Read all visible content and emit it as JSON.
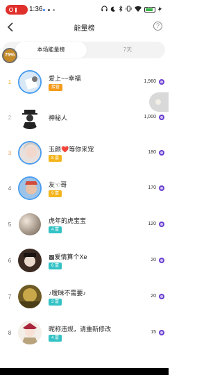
{
  "status_bar": {
    "time": "1:36",
    "battery": "68",
    "icons": [
      "headphones-icon",
      "moon-icon",
      "bluetooth-icon",
      "vibrate-icon",
      "wifi-icon",
      "battery-icon",
      "charging-icon"
    ]
  },
  "header": {
    "title": "能量榜",
    "help": "?"
  },
  "tabs": [
    {
      "label": "本场能量榜",
      "active": true
    },
    {
      "label": "7天",
      "active": false
    }
  ],
  "progress_badge": "75%",
  "rows": [
    {
      "rank": "1",
      "name": "爱上~~幸福",
      "badge": "接管",
      "badge_color": "orange",
      "score": "1,960"
    },
    {
      "rank": "2",
      "name": "神秘人",
      "badge": "",
      "badge_color": "",
      "score": "1,000"
    },
    {
      "rank": "3",
      "name": "玉颜❤️等你来宠",
      "badge": "8 富",
      "badge_color": "yellow",
      "score": "180"
    },
    {
      "rank": "4",
      "name": "友☜哥",
      "badge": "9 富",
      "badge_color": "yellow",
      "score": "170"
    },
    {
      "rank": "5",
      "name": "虎年的虎宝宝",
      "badge": "4 富",
      "badge_color": "teal",
      "score": "120"
    },
    {
      "rank": "6",
      "name": "▩爱情算个Xe",
      "badge": "6 富",
      "badge_color": "teal",
      "score": "20"
    },
    {
      "rank": "7",
      "name": "♪暧昧不需要♪",
      "badge": "3 富",
      "badge_color": "teal",
      "score": "20"
    },
    {
      "rank": "8",
      "name": "昵称违规，请重新修改",
      "badge": "4 富",
      "badge_color": "teal",
      "score": "15"
    }
  ]
}
